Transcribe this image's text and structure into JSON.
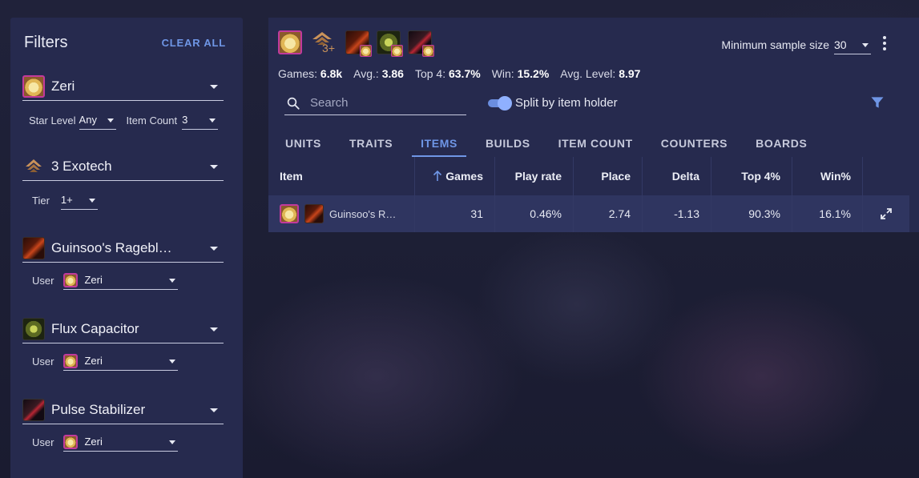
{
  "sidebar": {
    "title": "Filters",
    "clear_all": "CLEAR ALL",
    "unit_filter": {
      "name": "Zeri",
      "star_level_label": "Star Level",
      "star_level_value": "Any",
      "item_count_label": "Item Count",
      "item_count_value": "3"
    },
    "trait_filter": {
      "name": "3 Exotech",
      "tier_label": "Tier",
      "tier_value": "1+"
    },
    "item_filters": [
      {
        "name": "Guinsoo's Ragebl…",
        "user_label": "User",
        "user_value": "Zeri"
      },
      {
        "name": "Flux Capacitor",
        "user_label": "User",
        "user_value": "Zeri"
      },
      {
        "name": "Pulse Stabilizer",
        "user_label": "User",
        "user_value": "Zeri"
      }
    ]
  },
  "header": {
    "trait_chip_number": "3+",
    "sample_label": "Minimum sample size",
    "sample_value": "30"
  },
  "stats": {
    "games_label": "Games:",
    "games_value": "6.8k",
    "avg_label": "Avg.:",
    "avg_value": "3.86",
    "top4_label": "Top 4:",
    "top4_value": "63.7%",
    "win_label": "Win:",
    "win_value": "15.2%",
    "level_label": "Avg. Level:",
    "level_value": "8.97"
  },
  "search": {
    "placeholder": "Search"
  },
  "toggle": {
    "label": "Split by item holder",
    "on": true
  },
  "tabs": [
    "UNITS",
    "TRAITS",
    "ITEMS",
    "BUILDS",
    "ITEM COUNT",
    "COUNTERS",
    "BOARDS"
  ],
  "active_tab": "ITEMS",
  "table": {
    "columns": {
      "item": "Item",
      "games": "Games",
      "play_rate": "Play rate",
      "place": "Place",
      "delta": "Delta",
      "top4": "Top 4%",
      "win": "Win%"
    },
    "rows": [
      {
        "item": "Guinsoo's R…",
        "games": "31",
        "play_rate": "0.46%",
        "place": "2.74",
        "delta": "-1.13",
        "top4": "90.3%",
        "win": "16.1%"
      }
    ]
  },
  "colors": {
    "accent": "#6f96e6",
    "panel": "#262a4e",
    "row": "#2f3560",
    "zeri_border": "#c23a9c"
  }
}
